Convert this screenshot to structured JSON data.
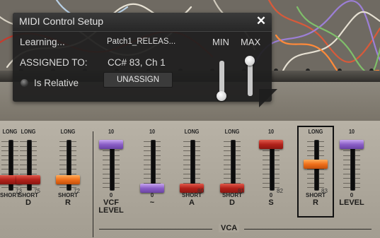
{
  "dialog": {
    "title": "MIDI Control Setup",
    "learning_label": "Learning...",
    "patch_name": "Patch1_RELEAS...",
    "assigned_label": "ASSIGNED TO:",
    "assigned_value": "CC# 83, Ch 1",
    "relative_label": "Is Relative",
    "unassign_label": "UNASSIGN",
    "min_label": "MIN",
    "max_label": "MAX",
    "min_value": 0.0,
    "max_value": 1.0
  },
  "synth": {
    "section_label": "VCA",
    "faders": [
      {
        "id": "f0",
        "top": "LONG",
        "bottom": "SHORT",
        "name": "",
        "cc": "73",
        "color": "red",
        "level": 0.2
      },
      {
        "id": "f1",
        "top": "LONG",
        "bottom": "SHORT",
        "name": "D",
        "cc": "75",
        "color": "red",
        "level": 0.2
      },
      {
        "id": "f2",
        "top": "LONG",
        "bottom": "SHORT",
        "name": "R",
        "cc": "72",
        "color": "orange",
        "level": 0.2
      },
      {
        "id": "f3",
        "top": "10",
        "bottom": "0",
        "name": "VCF\nLEVEL",
        "cc": "",
        "color": "purple",
        "level": 1.0
      },
      {
        "id": "f4",
        "top": "10",
        "bottom": "0",
        "name": "~",
        "cc": "",
        "color": "purple",
        "level": 0.0
      },
      {
        "id": "f5",
        "top": "LONG",
        "bottom": "SHORT",
        "name": "A",
        "cc": "80",
        "color": "red",
        "level": 0.0
      },
      {
        "id": "f6",
        "top": "LONG",
        "bottom": "SHORT",
        "name": "D",
        "cc": "81",
        "color": "red",
        "level": 0.0
      },
      {
        "id": "f7",
        "top": "10",
        "bottom": "0",
        "name": "S",
        "cc": "82",
        "color": "red",
        "level": 1.0
      },
      {
        "id": "f8",
        "top": "LONG",
        "bottom": "SHORT",
        "name": "R",
        "cc": "83",
        "color": "orange",
        "level": 0.55
      },
      {
        "id": "f9",
        "top": "10",
        "bottom": "0",
        "name": "LEVEL",
        "cc": "",
        "color": "purple",
        "level": 1.0
      }
    ],
    "selected_fader": "f8"
  },
  "colors": {
    "dialog_bg": "#1e1e1e",
    "cap_red": "#b2221a",
    "cap_orange": "#ef6f1a",
    "cap_purple": "#8b5fc7"
  }
}
